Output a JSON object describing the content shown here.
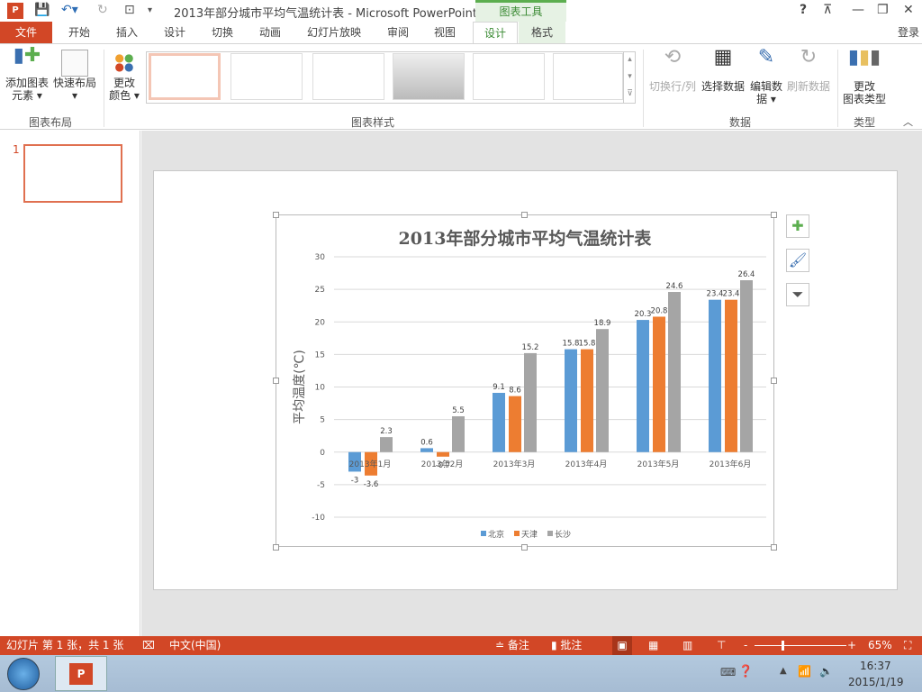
{
  "window": {
    "title": "2013年部分城市平均气温统计表 - Microsoft PowerPoint",
    "context_tab": "图表工具",
    "help": "?",
    "signin": "登录"
  },
  "tabs": [
    {
      "label": "文件"
    },
    {
      "label": "开始"
    },
    {
      "label": "插入"
    },
    {
      "label": "设计"
    },
    {
      "label": "切换"
    },
    {
      "label": "动画"
    },
    {
      "label": "幻灯片放映"
    },
    {
      "label": "审阅"
    },
    {
      "label": "视图"
    },
    {
      "label": "设计"
    },
    {
      "label": "格式"
    }
  ],
  "ribbon": {
    "add_element": "添加图表",
    "add_element2": "元素",
    "quick_layout": "快速布局",
    "change_color": "更改",
    "change_color2": "颜色",
    "group_layout": "图表布局",
    "group_styles": "图表样式",
    "switch_row_col": "切换行/列",
    "select_data": "选择数据",
    "edit_data": "编辑数",
    "edit_data2": "据",
    "refresh_data": "刷新数据",
    "group_data": "数据",
    "change_type": "更改",
    "change_type2": "图表类型",
    "group_type": "类型"
  },
  "slides_panel": {
    "slide_number": "1"
  },
  "status": {
    "slide_info": "幻灯片 第 1 张，共 1 张",
    "language": "中文(中国)",
    "notes": "备注",
    "comments": "批注",
    "zoom": "65%"
  },
  "taskbar": {
    "time": "16:37",
    "date": "2015/1/19"
  },
  "colors": {
    "accent": "#d24726",
    "beijing": "#5b9bd5",
    "tianjin": "#ed7d31",
    "changsha": "#a5a5a5"
  },
  "chart_data": {
    "type": "bar",
    "title": "2013年部分城市平均气温统计表",
    "ylabel": "平均温度(℃)",
    "xlabel": "",
    "ylim": [
      -10,
      30
    ],
    "yticks": [
      30,
      25,
      20,
      15,
      10,
      5,
      0,
      -5,
      -10
    ],
    "categories": [
      "2013年1月",
      "2013年2月",
      "2013年3月",
      "2013年4月",
      "2013年5月",
      "2013年6月"
    ],
    "series": [
      {
        "name": "北京",
        "values": [
          -3,
          0.6,
          9.1,
          15.8,
          20.3,
          23.4
        ]
      },
      {
        "name": "天津",
        "values": [
          -3.6,
          -0.7,
          8.6,
          15.8,
          20.8,
          23.4
        ]
      },
      {
        "name": "长沙",
        "values": [
          2.3,
          5.5,
          15.2,
          18.9,
          24.6,
          26.4
        ]
      }
    ],
    "legend": "bottom",
    "grid": true
  }
}
